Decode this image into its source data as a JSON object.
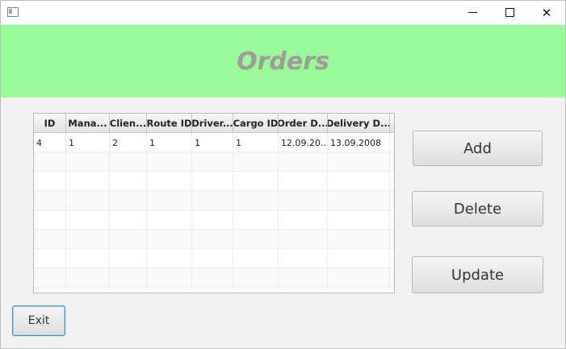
{
  "window": {
    "minimize_glyph": "",
    "maximize_glyph": "",
    "close_glyph": "✕"
  },
  "header": {
    "title": "Orders",
    "background": "#98fb98",
    "title_color": "#a09a9a"
  },
  "table": {
    "columns": [
      "ID",
      "Mana...",
      "Clien...",
      "Route ID",
      "Driver...",
      "Cargo ID",
      "Order D...",
      "Delivery D..."
    ],
    "rows": [
      [
        "4",
        "1",
        "2",
        "1",
        "1",
        "1",
        "12.09.20...",
        "13.09.2008"
      ]
    ]
  },
  "buttons": {
    "add": "Add",
    "delete": "Delete",
    "update": "Update",
    "exit": "Exit"
  },
  "icons": {
    "app": "app-window-icon",
    "minimize": "minimize-icon",
    "maximize": "maximize-icon",
    "close": "close-icon"
  }
}
